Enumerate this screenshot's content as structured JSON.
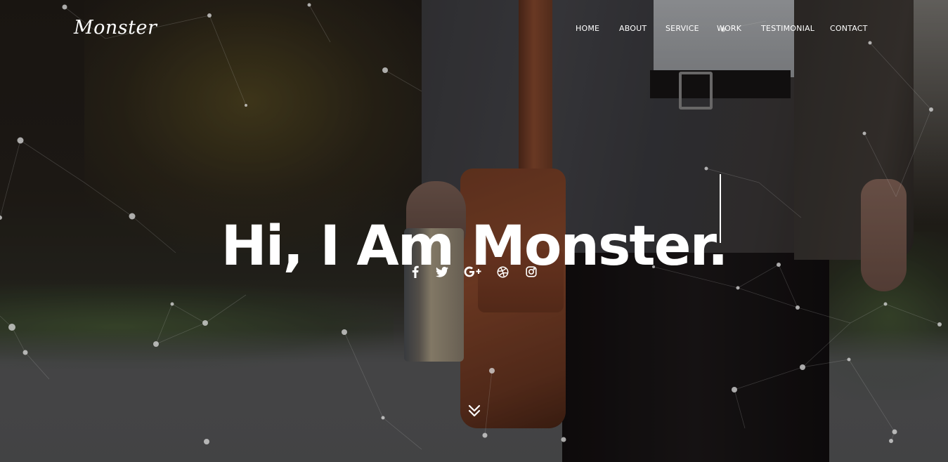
{
  "brand": {
    "logo_text": "Monster"
  },
  "nav": {
    "items": [
      {
        "label": "HOME"
      },
      {
        "label": "ABOUT"
      },
      {
        "label": "SERVICE"
      },
      {
        "label": "WORK"
      },
      {
        "label": "TESTIMONIAL"
      },
      {
        "label": "CONTACT"
      }
    ]
  },
  "hero": {
    "headline": "Hi, I Am Monster.",
    "social_icons": [
      "facebook-icon",
      "twitter-icon",
      "google-plus-icon",
      "dribbble-icon",
      "instagram-icon"
    ],
    "scroll_icon": "double-chevron-down-icon"
  },
  "colors": {
    "text": "#ffffff",
    "overlay": "#0a0808",
    "particle": "#d9d9d9"
  }
}
